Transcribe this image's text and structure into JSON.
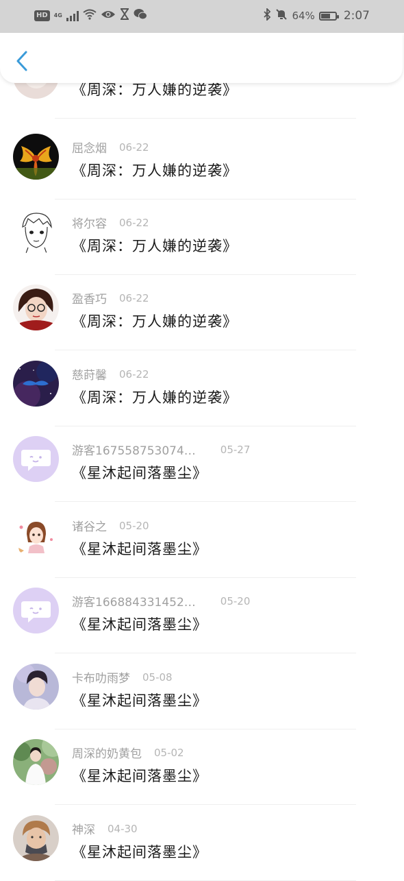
{
  "status_bar": {
    "hd": "HD",
    "network": "4G",
    "battery_percent": "64%",
    "battery_level": 0.64,
    "time": "2:07",
    "icons": [
      "signal-icon",
      "wifi-icon",
      "eye-icon",
      "hourglass-icon",
      "wechat-icon",
      "bluetooth-icon",
      "mute-icon",
      "battery-icon"
    ]
  },
  "nav": {
    "back_icon": "chevron-left-icon",
    "accent": "#3a9bd9"
  },
  "items": [
    {
      "name": "",
      "date": "",
      "book": "《周深：万人嫌的逆袭》"
    },
    {
      "name": "屈念烟",
      "date": "06-22",
      "book": "《周深：万人嫌的逆袭》"
    },
    {
      "name": "将尔容",
      "date": "06-22",
      "book": "《周深：万人嫌的逆袭》"
    },
    {
      "name": "盈香巧",
      "date": "06-22",
      "book": "《周深：万人嫌的逆袭》"
    },
    {
      "name": "慈莳馨",
      "date": "06-22",
      "book": "《周深：万人嫌的逆袭》"
    },
    {
      "name": "游客167558753074…",
      "date": "05-27",
      "book": "《星沐起间落墨尘》"
    },
    {
      "name": "诸谷之",
      "date": "05-20",
      "book": "《星沐起间落墨尘》"
    },
    {
      "name": "游客166884331452…",
      "date": "05-20",
      "book": "《星沐起间落墨尘》"
    },
    {
      "name": "卡布叻雨梦",
      "date": "05-08",
      "book": "《星沐起间落墨尘》"
    },
    {
      "name": "周深的奶黄包",
      "date": "05-02",
      "book": "《星沐起间落墨尘》"
    },
    {
      "name": "神深",
      "date": "04-30",
      "book": "《星沐起间落墨尘》"
    }
  ]
}
